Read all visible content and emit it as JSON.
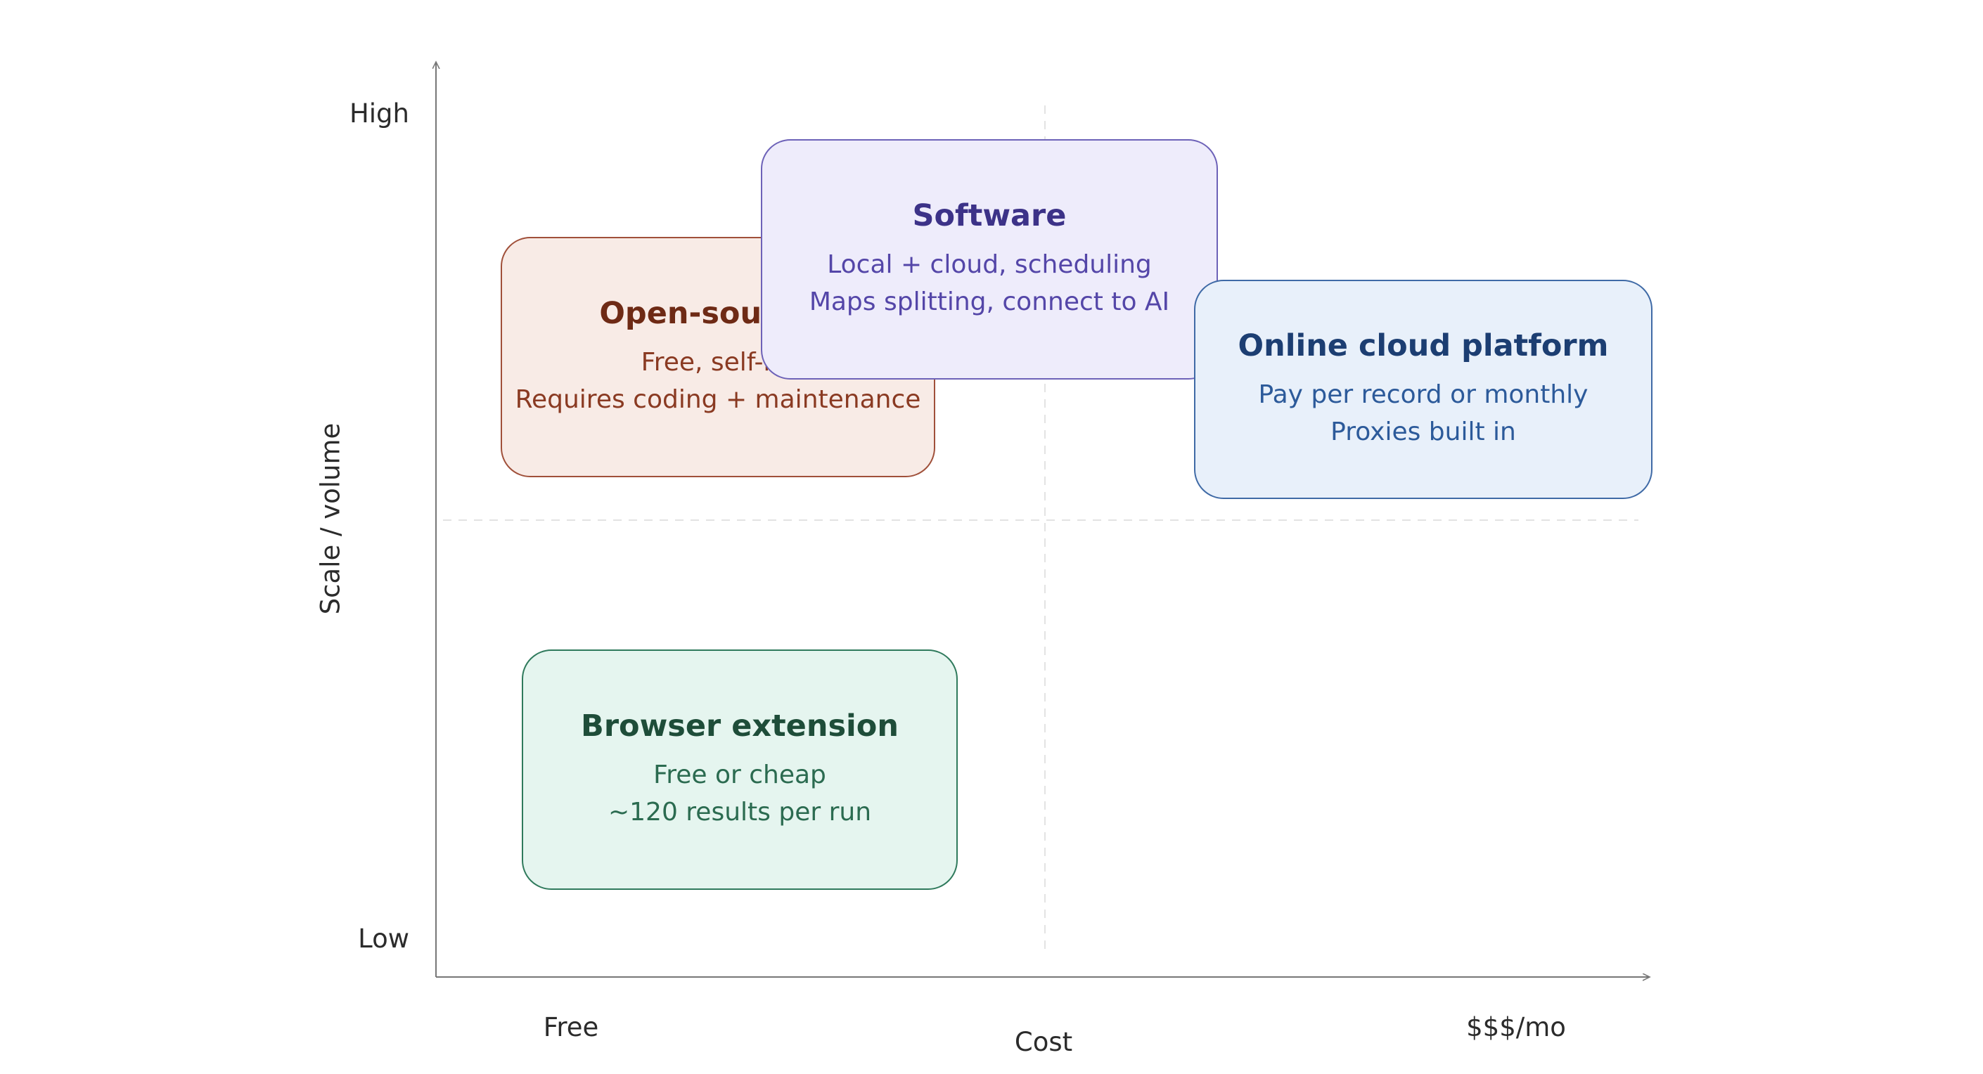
{
  "axes": {
    "y_label": "Scale / volume",
    "y_high": "High",
    "y_low": "Low",
    "x_label": "Cost",
    "x_low": "Free",
    "x_high": "$$$/mo"
  },
  "quadrants": {
    "open_source": {
      "title": "Open-source /",
      "line1": "Free, self-ho",
      "line2": "Requires coding + maintenance",
      "fill": "#f8ebe6",
      "border": "#a0503a",
      "title_color": "#6e2a15",
      "text_color": "#8a3a22"
    },
    "software": {
      "title": "Software",
      "line1": "Local + cloud, scheduling",
      "line2": "Maps splitting, connect to AI",
      "fill": "#eeecfb",
      "border": "#6d62b8",
      "title_color": "#3c3288",
      "text_color": "#5446a8"
    },
    "online_cloud": {
      "title": "Online cloud platform",
      "line1": "Pay per record or monthly",
      "line2": "Proxies built in",
      "fill": "#e8f0fa",
      "border": "#3f6aa6",
      "title_color": "#1c3e72",
      "text_color": "#2c5a9a"
    },
    "browser_extension": {
      "title": "Browser extension",
      "line1": "Free or cheap",
      "line2": "~120 results per run",
      "fill": "#e5f5ef",
      "border": "#2f7a5c",
      "title_color": "#1e4d39",
      "text_color": "#2b6b50"
    }
  }
}
